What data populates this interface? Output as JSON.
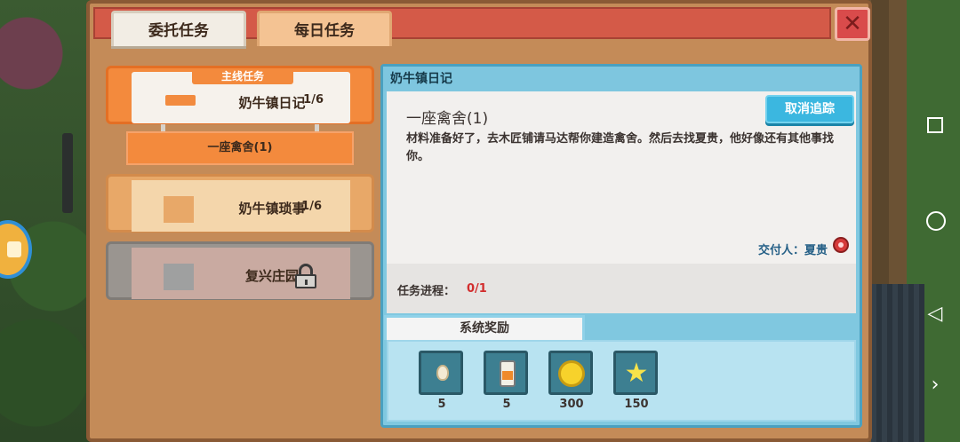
{
  "tabs": {
    "commission": "委托任务",
    "daily": "每日任务"
  },
  "close_label": "✕",
  "quests": {
    "main": {
      "tag": "主线任务",
      "name": "奶牛镇日记",
      "count": "1/6"
    },
    "subtask": "一座禽舍(1)",
    "chores": {
      "name": "奶牛镇琐事",
      "count": "1/6"
    },
    "locked": {
      "name": "复兴庄园"
    }
  },
  "detail": {
    "header": "奶牛镇日记",
    "title": "一座禽舍(1)",
    "untrack_label": "取消追踪",
    "description": "材料准备好了，去木匠铺请马达帮你建造禽舍。然后去找夏贵，他好像还有其他事找你。",
    "giver": "交付人：夏贵",
    "progress_label": "任务进程：",
    "progress_value": "0/1",
    "reward_tab": "系统奖励",
    "rewards": [
      {
        "icon": "egg-icon",
        "qty": "5"
      },
      {
        "icon": "milk-bottle-icon",
        "qty": "5"
      },
      {
        "icon": "gold-coin-icon",
        "qty": "300"
      },
      {
        "icon": "star-icon",
        "qty": "150"
      }
    ]
  },
  "colors": {
    "title_bar": "#d45a48",
    "active_quest": "#f38a3d",
    "detail_accent": "#80c8e0",
    "untrack_button": "#3bb7e0",
    "progress_value": "#d22d2d"
  }
}
